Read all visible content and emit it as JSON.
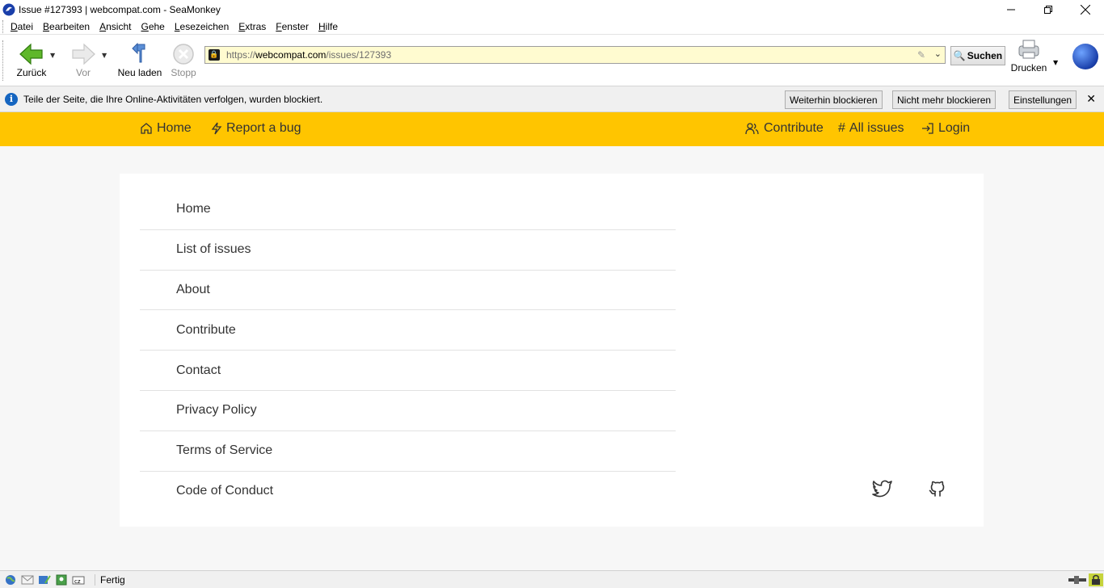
{
  "window": {
    "title": "Issue #127393 | webcompat.com - SeaMonkey"
  },
  "menubar": {
    "items": [
      "Datei",
      "Bearbeiten",
      "Ansicht",
      "Gehe",
      "Lesezeichen",
      "Extras",
      "Fenster",
      "Hilfe"
    ]
  },
  "toolbar": {
    "back_label": "Zurück",
    "forward_label": "Vor",
    "reload_label": "Neu laden",
    "stop_label": "Stopp",
    "url_scheme": "https://",
    "url_host": "webcompat.com",
    "url_path": "/issues/127393",
    "search_label": "Suchen",
    "print_label": "Drucken"
  },
  "notification": {
    "message": "Teile der Seite, die Ihre Online-Aktivitäten verfolgen, wurden blockiert.",
    "keep_blocking": "Weiterhin blockieren",
    "unblock": "Nicht mehr blockieren",
    "settings": "Einstellungen"
  },
  "site_nav": {
    "home": "Home",
    "report": "Report a bug",
    "contribute": "Contribute",
    "all_issues": "All issues",
    "login": "Login"
  },
  "footer": {
    "links": [
      "Home",
      "List of issues",
      "About",
      "Contribute",
      "Contact",
      "Privacy Policy",
      "Terms of Service",
      "Code of Conduct"
    ]
  },
  "statusbar": {
    "text": "Fertig"
  },
  "colors": {
    "accent": "#ffc500",
    "url_bg": "#fffbd0",
    "info": "#1565c0"
  }
}
